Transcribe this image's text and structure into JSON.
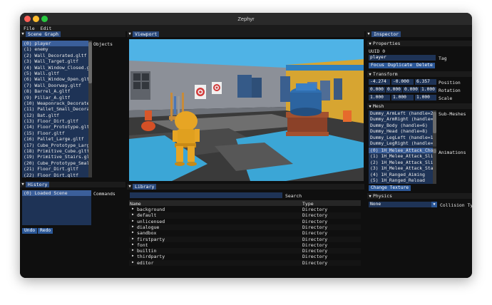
{
  "window": {
    "title": "Zephyr"
  },
  "menu": [
    "File",
    "Edit"
  ],
  "scene_graph": {
    "title": "Scene Graph",
    "objects_label": "Objects",
    "items": [
      "(0) player",
      "(1) enemy",
      "(2) Wall_Decorated.gltf",
      "(3) Wall_Target.gltf",
      "(4) Wall_Window_Closed.glt",
      "(5) Wall.gltf",
      "(6) Wall_Window_Open.gltf",
      "(7) Wall_Doorway.gltf",
      "(8) Barrel_A.gltf",
      "(9) Pillar_A.gltf",
      "(10) Weaponrack_Decorated.",
      "(11) Pallet_Small_Decorate",
      "(12) Bat.gltf",
      "(13) Floor_Dirt.gltf",
      "(14) Floor_Prototype.gltf",
      "(15) Floor.gltf",
      "(16) Pallet_Large.gltf",
      "(17) Cube_Prototype_Large_",
      "(18) Primitive_Cube.gltf",
      "(19) Primitive_Stairs.glt",
      "(20) Cube_Prototype_Small",
      "(21) Floor_Dirt.gltf",
      "(22) Floor_Dirt.gltf"
    ]
  },
  "history": {
    "title": "History",
    "commands_label": "Commands",
    "items": [
      "(0) Loaded Scene"
    ],
    "undo": "Undo",
    "redo": "Redo"
  },
  "viewport": {
    "title": "Viewport"
  },
  "library": {
    "title": "Library",
    "search_label": "Search",
    "search_value": "",
    "col_name": "Name",
    "col_type": "Type",
    "rows": [
      {
        "name": "background",
        "type": "Directory"
      },
      {
        "name": "default",
        "type": "Directory"
      },
      {
        "name": "unlicensed",
        "type": "Directory"
      },
      {
        "name": "dialogue",
        "type": "Directory"
      },
      {
        "name": "sandbox",
        "type": "Directory"
      },
      {
        "name": "firstparty",
        "type": "Directory"
      },
      {
        "name": "font",
        "type": "Directory"
      },
      {
        "name": "builtin",
        "type": "Directory"
      },
      {
        "name": "thirdparty",
        "type": "Directory"
      },
      {
        "name": "editor",
        "type": "Directory"
      }
    ]
  },
  "inspector": {
    "title": "Inspector",
    "properties_label": "Properties",
    "uuid": "UUID 0",
    "tag_value": "player",
    "tag_label": "Tag",
    "focus": "Focus",
    "duplicate": "Duplicate",
    "delete": "Delete",
    "transform_label": "Transform",
    "position": [
      "-4.274",
      "-0.000",
      "6.357"
    ],
    "position_label": "Position",
    "rotation": [
      "0.000",
      "0.000",
      "0.000",
      "1.000"
    ],
    "rotation_label": "Rotation",
    "scale": [
      "1.000",
      "1.000",
      "1.000"
    ],
    "scale_label": "Scale",
    "mesh_label": "Mesh",
    "submeshes_label": "Sub-Meshes",
    "submeshes": [
      "Dummy_ArmLeft (handle=2)",
      "Dummy_ArmRight (handle=4)",
      "Dummy_Body (handle=6)",
      "Dummy_Head (handle=8)",
      "Dummy_LegLeft (handle=10)",
      "Dummy_LegRight (handle=12"
    ],
    "animations_label": "Animations",
    "animations": [
      "(0) 1H_Melee_Attack_Chop",
      "(1) 1H_Melee_Attack_Slice_",
      "(2) 1H_Melee_Attack_Slice_",
      "(3) 1H_Melee_Attack_Stab",
      "(4) 1H_Ranged_Aiming",
      "(5) 1H_Ranged_Reload"
    ],
    "change_texture": "Change Texture",
    "physics_label": "Physics",
    "collision_value": "None",
    "collision_label": "Collision Type"
  }
}
